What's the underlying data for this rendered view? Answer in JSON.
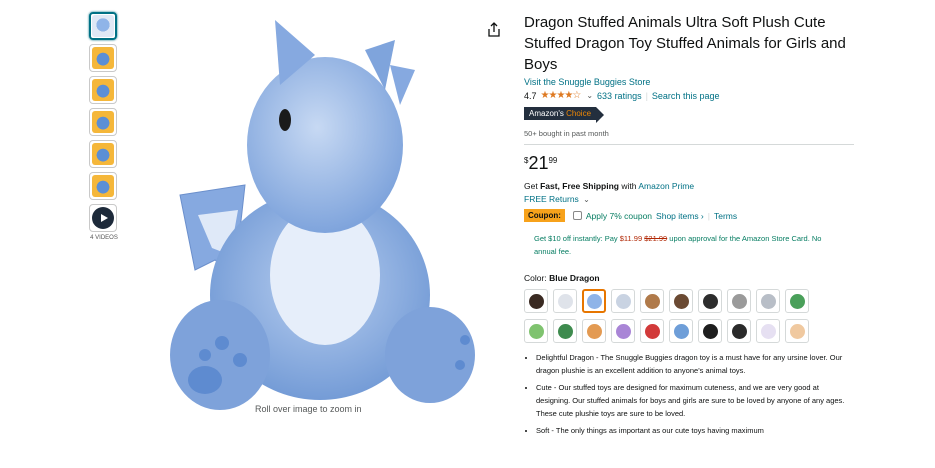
{
  "thumbnails": [
    {
      "style": "blue",
      "icon": "plush-dragon-thumb",
      "selected": true
    },
    {
      "style": "yellow",
      "icon": "plush-dragon-thumb"
    },
    {
      "style": "yellow",
      "icon": "plush-dragon-thumb"
    },
    {
      "style": "yellow",
      "icon": "plush-dragon-thumb"
    },
    {
      "style": "yellow",
      "icon": "plush-dragon-thumb"
    },
    {
      "style": "yellow",
      "icon": "plush-dragon-thumb"
    },
    {
      "style": "video",
      "icon": "play-icon"
    }
  ],
  "videos_label": "4 VIDEOS",
  "zoom_hint": "Roll over image to zoom in",
  "product": {
    "title": "Dragon Stuffed Animals Ultra Soft Plush Cute Stuffed Dragon Toy Stuffed Animals for Girls and Boys",
    "store_link": "Visit the Snuggle Buggies Store",
    "rating": "4.7",
    "stars": "★★★★☆",
    "ratings_count": "633 ratings",
    "search_page": "Search this page",
    "badge_prefix": "Amazon's",
    "badge_suffix": "Choice",
    "bought": "50+ bought in past month",
    "price_symbol": "$",
    "price_whole": "21",
    "price_frac": "99",
    "ship_prefix": "Get",
    "ship_bold": "Fast, Free Shipping",
    "ship_mid": "with",
    "ship_link": "Amazon Prime",
    "returns": "FREE Returns",
    "coupon_tag": "Coupon:",
    "coupon_apply": "Apply 7% coupon",
    "coupon_shop": "Shop items ›",
    "coupon_terms": "Terms",
    "offer_text_1": "Get $10 off instantly: Pay",
    "offer_price": "$11.99",
    "offer_strike": "$21.99",
    "offer_text_2": "upon approval for the Amazon Store Card. No annual fee.",
    "color_label": "Color:",
    "color_value": "Blue Dragon"
  },
  "swatches": [
    {
      "color": "#3a2a22"
    },
    {
      "color": "#dfe3ea"
    },
    {
      "color": "#8fb4e8",
      "selected": true
    },
    {
      "color": "#c9d3e2"
    },
    {
      "color": "#b07a4a"
    },
    {
      "color": "#6b4a33"
    },
    {
      "color": "#2d2d2d"
    },
    {
      "color": "#9a9a9a"
    },
    {
      "color": "#b8bec7"
    },
    {
      "color": "#4aa05a"
    },
    {
      "color": "#7fc36f"
    },
    {
      "color": "#3e8b4e"
    },
    {
      "color": "#e39a52"
    },
    {
      "color": "#a985d6"
    },
    {
      "color": "#d23a3a"
    },
    {
      "color": "#6e9ed8"
    },
    {
      "color": "#1e1e1e"
    },
    {
      "color": "#2a2a2a"
    },
    {
      "color": "#e6e0f2"
    },
    {
      "color": "#f0c9a0"
    }
  ],
  "bullets": [
    "Delightful Dragon - The Snuggle Buggies dragon toy is a must have for any ursine lover. Our dragon plushie is an excellent addition to anyone's animal toys.",
    "Cute - Our stuffed toys are designed for maximum cuteness, and we are very good at designing. Our stuffed animals for boys and girls are sure to be loved by anyone of any ages. These cute plushie toys are sure to be loved.",
    "Soft - The only things as important as our cute toys having maximum"
  ]
}
